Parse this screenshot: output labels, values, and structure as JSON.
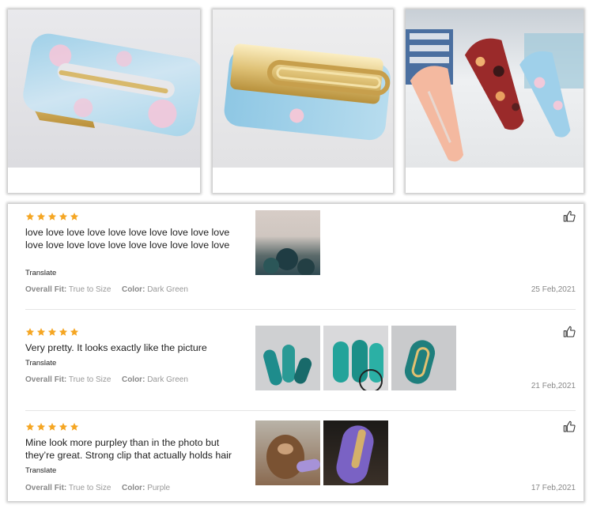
{
  "reviews": [
    {
      "rating": 5,
      "text": "love love love love love love love love love love love love love love love love love love love love",
      "translate_label": "Translate",
      "fit_label": "Overall Fit:",
      "fit_value": "True to Size",
      "color_label": "Color:",
      "color_value": "Dark Green",
      "date": "25 Feb,2021"
    },
    {
      "rating": 5,
      "text": "Very pretty. It looks exactly like the picture",
      "translate_label": "Translate",
      "fit_label": "Overall Fit:",
      "fit_value": "True to Size",
      "color_label": "Color:",
      "color_value": "Dark Green",
      "date": "21 Feb,2021"
    },
    {
      "rating": 5,
      "text": "Mine look more purpley than in the photo but they’re great. Strong clip that actually holds hair",
      "translate_label": "Translate",
      "fit_label": "Overall Fit:",
      "fit_value": "True to Size",
      "color_label": "Color:",
      "color_value": "Purple",
      "date": "17 Feb,2021"
    }
  ],
  "icons": {
    "star": "star-icon",
    "like": "thumbs-up-icon"
  },
  "colors": {
    "star": "#f5a623",
    "meta_label": "#888888",
    "date": "#888888"
  }
}
